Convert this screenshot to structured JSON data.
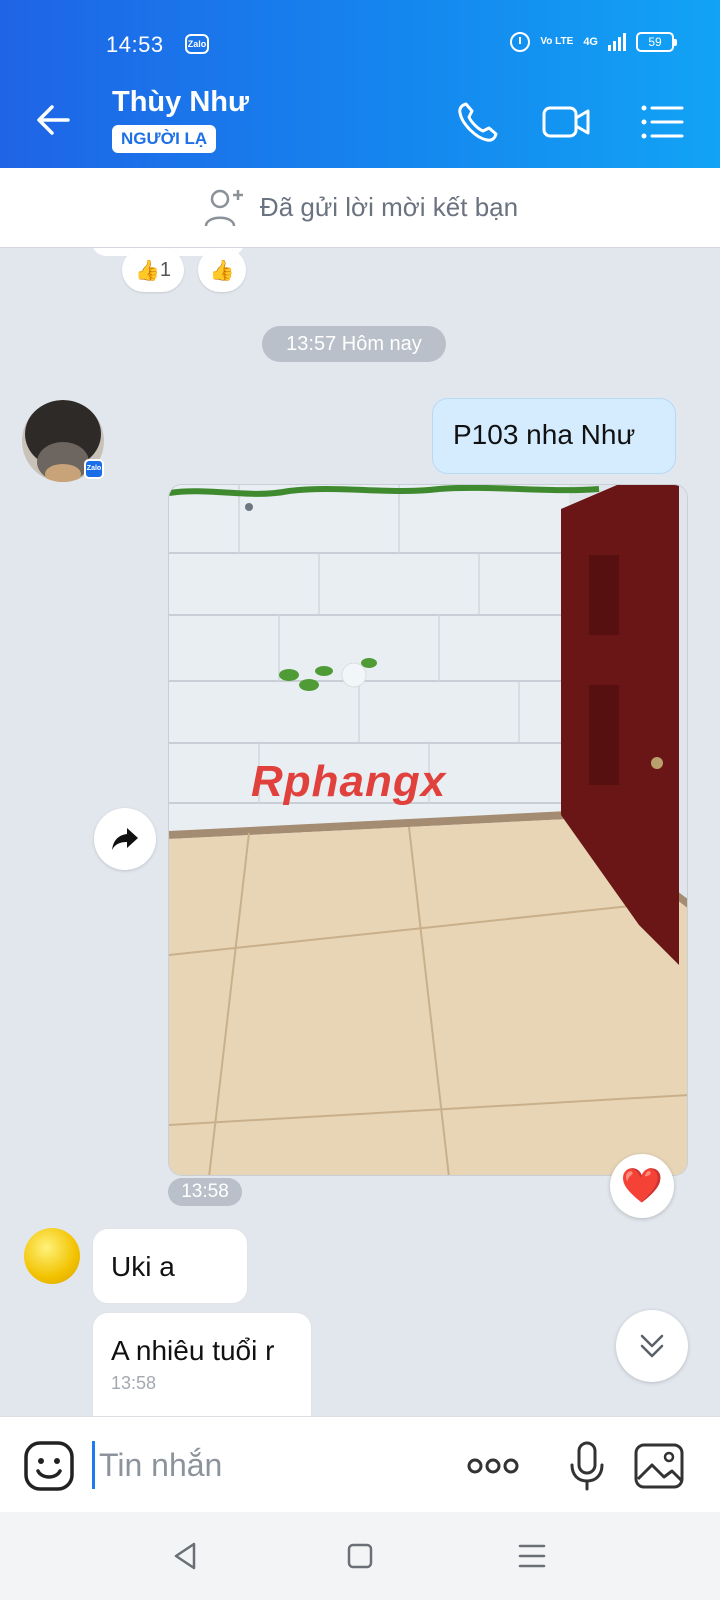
{
  "status_bar": {
    "time": "14:53",
    "zalo_badge": "Zalo",
    "volte": "Vo LTE",
    "network": "4G",
    "battery": "59"
  },
  "header": {
    "contact_name": "Thùy Như",
    "stranger_label": "NGƯỜI LẠ",
    "icons": [
      "back-arrow-icon",
      "phone-icon",
      "video-camera-icon",
      "menu-list-icon"
    ]
  },
  "friend_request": {
    "text": "Đã gửi lời mời kết bạn",
    "icon": "add-person-icon"
  },
  "chat": {
    "reactions": [
      {
        "emoji": "👍",
        "count": "1"
      },
      {
        "emoji": "👍",
        "count": ""
      }
    ],
    "day_separator": "13:57 Hôm nay",
    "outgoing_message": "P103 nha Như",
    "photo": {
      "watermark": "Rphangx"
    },
    "photo_time": "13:58",
    "incoming_messages": [
      {
        "text": "Uki a"
      },
      {
        "text": "A nhiêu tuổi r",
        "time": "13:58"
      }
    ],
    "reaction_heart": "❤️",
    "avatar_badge": "Zalo"
  },
  "input_bar": {
    "placeholder": "Tin nhắn"
  },
  "colors": {
    "header_start": "#1f64e6",
    "header_end": "#12a3f5",
    "chat_bg": "#e2e7ee",
    "outgoing_bubble": "#d5ecff",
    "accent": "#1f6fe6"
  }
}
